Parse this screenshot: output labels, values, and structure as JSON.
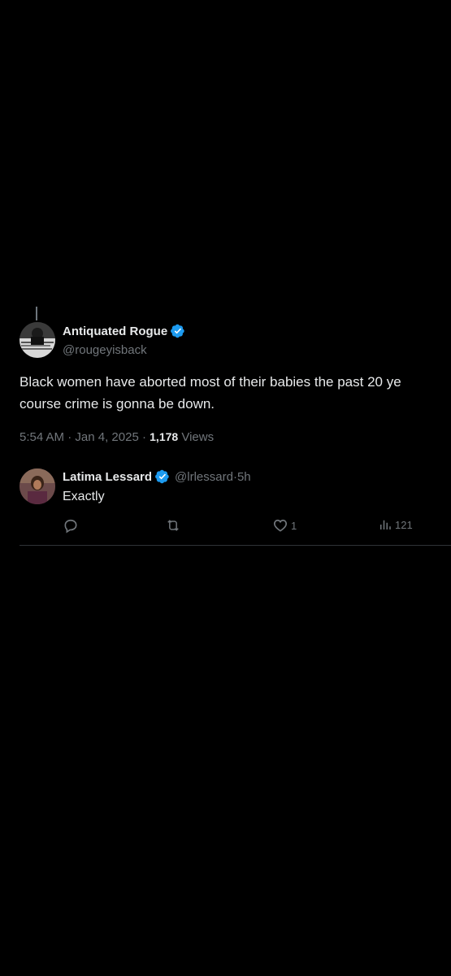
{
  "tweet": {
    "author_name": "Antiquated Rogue",
    "author_handle": "@rougeyisback",
    "text_line1": "Black women have aborted most of their babies the past 20 ye",
    "text_line2": "course crime is gonna be down.",
    "time": "5:54 AM",
    "separator": " · ",
    "date": "Jan 4, 2025",
    "views_count": "1,178",
    "views_label": "Views"
  },
  "reply": {
    "author_name": "Latima Lessard",
    "author_handle": "@lrlessard",
    "age": "5h",
    "text": "Exactly",
    "actions": {
      "reply_icon": "reply-bubble-icon",
      "retweet_icon": "retweet-icon",
      "like_icon": "heart-icon",
      "like_count": "1",
      "views_icon": "views-chart-icon",
      "views_count": "121"
    }
  },
  "colors": {
    "background": "#000000",
    "text_primary": "#e7e9ea",
    "text_secondary": "#71767b",
    "verified": "#1d9bf0",
    "divider": "#2f3336"
  }
}
